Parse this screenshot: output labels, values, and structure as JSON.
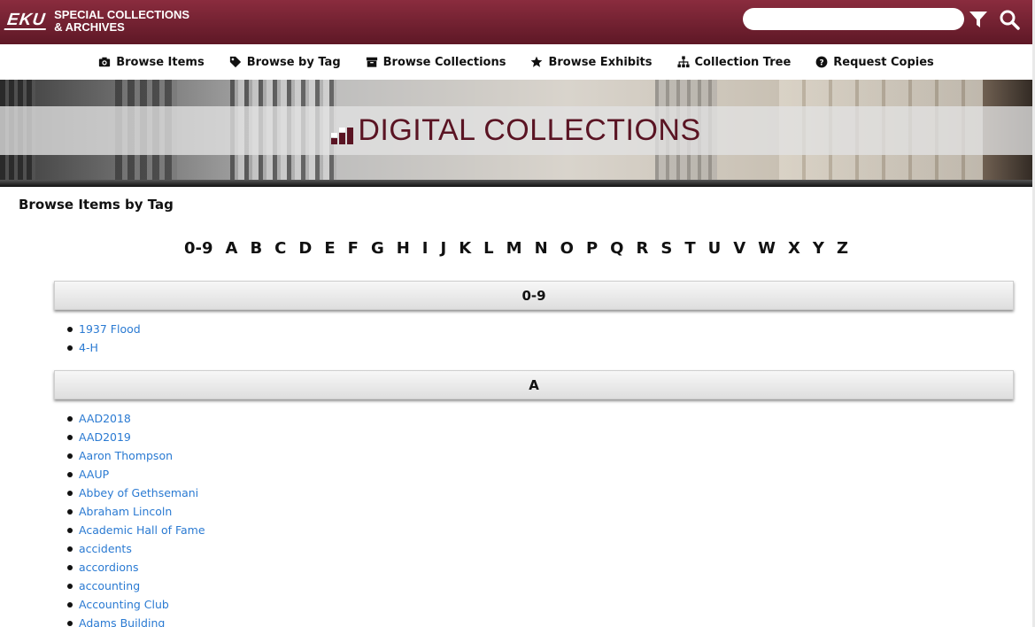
{
  "header": {
    "logo_text": "EKU",
    "site_title_line1": "SPECIAL COLLECTIONS",
    "site_title_line2": "& ARCHIVES",
    "search_value": "",
    "search_placeholder": "",
    "filter_icon": "filter-icon",
    "search_icon": "search-icon"
  },
  "nav": {
    "items": [
      {
        "label": "Browse Items",
        "icon": "camera-icon"
      },
      {
        "label": "Browse by Tag",
        "icon": "tag-icon"
      },
      {
        "label": "Browse Collections",
        "icon": "archive-box-icon"
      },
      {
        "label": "Browse Exhibits",
        "icon": "star-icon"
      },
      {
        "label": "Collection Tree",
        "icon": "sitemap-icon"
      },
      {
        "label": "Request Copies",
        "icon": "question-circle-icon"
      }
    ]
  },
  "banner": {
    "title": "DIGITAL COLLECTIONS"
  },
  "page": {
    "title": "Browse Items by Tag"
  },
  "alphabet": [
    "0-9",
    "A",
    "B",
    "C",
    "D",
    "E",
    "F",
    "G",
    "H",
    "I",
    "J",
    "K",
    "L",
    "M",
    "N",
    "O",
    "P",
    "Q",
    "R",
    "S",
    "T",
    "U",
    "V",
    "W",
    "X",
    "Y",
    "Z"
  ],
  "sections": [
    {
      "heading": "0-9",
      "tags": [
        "1937 Flood",
        "4-H"
      ]
    },
    {
      "heading": "A",
      "tags": [
        "AAD2018",
        "AAD2019",
        "Aaron Thompson",
        "AAUP",
        "Abbey of Gethsemani",
        "Abraham Lincoln",
        "Academic Hall of Fame",
        "accidents",
        "accordions",
        "accounting",
        "Accounting Club",
        "Adams Building"
      ]
    }
  ],
  "colors": {
    "header_maroon": "#6e1e2e",
    "banner_title": "#5a1423",
    "link_blue": "#2a7ad2"
  }
}
